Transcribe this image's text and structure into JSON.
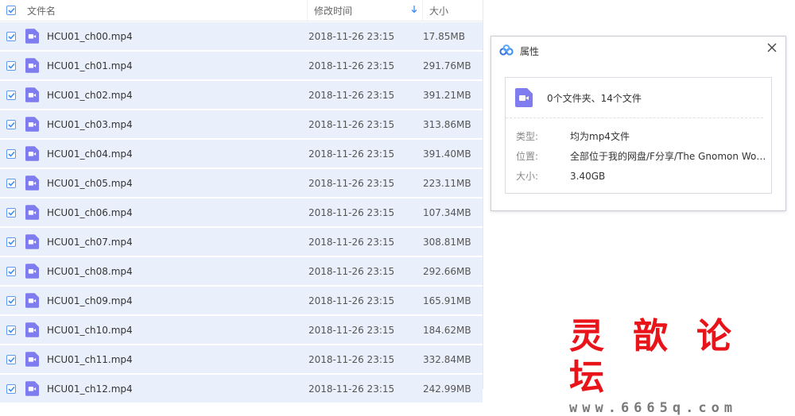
{
  "colors": {
    "accent": "#3b8cf2",
    "row_selected": "#eaf0fb",
    "video_icon": "#7f7cf0",
    "watermark_red": "#e8141a"
  },
  "header": {
    "select_all_checked": true,
    "col_name": "文件名",
    "col_date": "修改时间",
    "col_size": "大小",
    "sort_icon": "arrow-down-icon"
  },
  "files": [
    {
      "name": "HCU01_ch00.mp4",
      "date": "2018-11-26 23:15",
      "size": "17.85MB",
      "checked": true
    },
    {
      "name": "HCU01_ch01.mp4",
      "date": "2018-11-26 23:15",
      "size": "291.76MB",
      "checked": true
    },
    {
      "name": "HCU01_ch02.mp4",
      "date": "2018-11-26 23:15",
      "size": "391.21MB",
      "checked": true
    },
    {
      "name": "HCU01_ch03.mp4",
      "date": "2018-11-26 23:15",
      "size": "313.86MB",
      "checked": true
    },
    {
      "name": "HCU01_ch04.mp4",
      "date": "2018-11-26 23:15",
      "size": "391.40MB",
      "checked": true
    },
    {
      "name": "HCU01_ch05.mp4",
      "date": "2018-11-26 23:15",
      "size": "223.11MB",
      "checked": true
    },
    {
      "name": "HCU01_ch06.mp4",
      "date": "2018-11-26 23:15",
      "size": "107.34MB",
      "checked": true
    },
    {
      "name": "HCU01_ch07.mp4",
      "date": "2018-11-26 23:15",
      "size": "308.81MB",
      "checked": true
    },
    {
      "name": "HCU01_ch08.mp4",
      "date": "2018-11-26 23:15",
      "size": "292.66MB",
      "checked": true
    },
    {
      "name": "HCU01_ch09.mp4",
      "date": "2018-11-26 23:15",
      "size": "165.91MB",
      "checked": true
    },
    {
      "name": "HCU01_ch10.mp4",
      "date": "2018-11-26 23:15",
      "size": "184.62MB",
      "checked": true
    },
    {
      "name": "HCU01_ch11.mp4",
      "date": "2018-11-26 23:15",
      "size": "332.84MB",
      "checked": true
    },
    {
      "name": "HCU01_ch12.mp4",
      "date": "2018-11-26 23:15",
      "size": "242.99MB",
      "checked": true
    }
  ],
  "dialog": {
    "title": "属性",
    "logo_icon": "baidu-cloud-icon",
    "close_icon": "close-icon",
    "summary": "0个文件夹、14个文件",
    "props": [
      {
        "label": "类型:",
        "value": "均为mp4文件"
      },
      {
        "label": "位置:",
        "value": "全部位于我的网盘/F分享/The Gnomon Workshop"
      },
      {
        "label": "大小:",
        "value": "3.40GB"
      }
    ]
  },
  "watermark": {
    "title": "灵歆论坛",
    "url": "www.6665q.com"
  }
}
